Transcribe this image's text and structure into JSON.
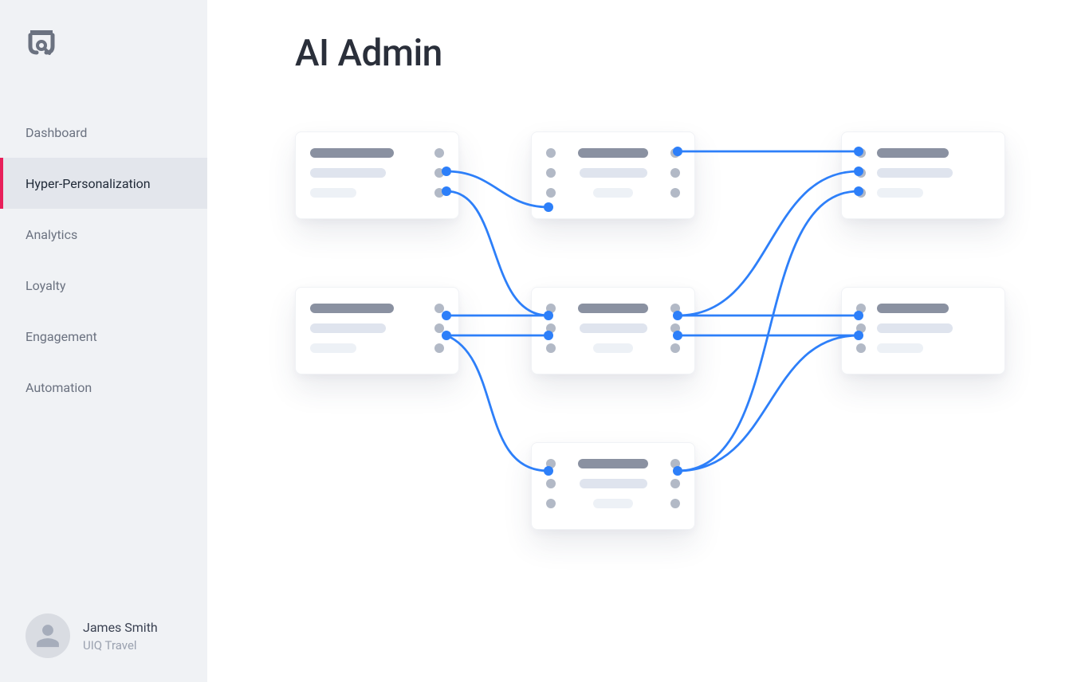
{
  "sidebar": {
    "items": [
      {
        "label": "Dashboard"
      },
      {
        "label": "Hyper-Personalization"
      },
      {
        "label": "Analytics"
      },
      {
        "label": "Loyalty"
      },
      {
        "label": "Engagement"
      },
      {
        "label": "Automation"
      }
    ]
  },
  "user": {
    "name": "James Smith",
    "org": "UIQ Travel"
  },
  "page": {
    "title": "AI Admin"
  }
}
